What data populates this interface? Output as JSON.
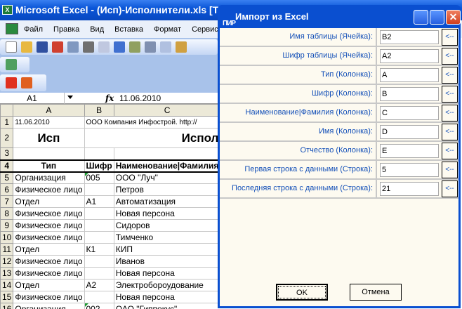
{
  "excel": {
    "title": "Microsoft Excel - (Исп)-Исполнители.xls  [Только чтение]",
    "menu": [
      "Файл",
      "Правка",
      "Вид",
      "Вставка",
      "Формат",
      "Сервис"
    ],
    "name_box": "A1",
    "fx_label": "fx",
    "formula_value": "11.06.2010",
    "columns": [
      "A",
      "B",
      "C"
    ],
    "rows": [
      {
        "n": "1",
        "a": "11.06.2010",
        "b": "ООО Компания Инфострой. http://",
        "c": ""
      },
      {
        "n": "2",
        "a": "Исп",
        "b": "",
        "c": "Испол"
      },
      {
        "n": "3",
        "a": "",
        "b": "",
        "c": ""
      },
      {
        "n": "4",
        "a": "Тип",
        "b": "Шифр",
        "c": "Наименование|Фамилия"
      },
      {
        "n": "5",
        "a": "Организация",
        "b": "005",
        "c": "ООО \"Луч\""
      },
      {
        "n": "6",
        "a": "Физическое лицо",
        "b": "",
        "c": "Петров"
      },
      {
        "n": "7",
        "a": "Отдел",
        "b": "А1",
        "c": "Автоматизация"
      },
      {
        "n": "8",
        "a": "Физическое лицо",
        "b": "",
        "c": "Новая персона"
      },
      {
        "n": "9",
        "a": "Физическое лицо",
        "b": "",
        "c": "Сидоров"
      },
      {
        "n": "10",
        "a": "Физическое лицо",
        "b": "",
        "c": "Тимченко"
      },
      {
        "n": "11",
        "a": "Отдел",
        "b": "К1",
        "c": "КИП"
      },
      {
        "n": "12",
        "a": "Физическое лицо",
        "b": "",
        "c": "Иванов"
      },
      {
        "n": "13",
        "a": "Физическое лицо",
        "b": "",
        "c": "Новая персона"
      },
      {
        "n": "14",
        "a": "Отдел",
        "b": "А2",
        "c": "Электробороудование"
      },
      {
        "n": "15",
        "a": "Физическое лицо",
        "b": "",
        "c": "Новая персона"
      },
      {
        "n": "16",
        "a": "Организация",
        "b": "002",
        "c": "ОАО \"Гиппокус\""
      }
    ]
  },
  "dialog": {
    "icon_text": "ПИР",
    "title": "Импорт из Excel",
    "fields": [
      {
        "label": "Имя таблицы (Ячейка):",
        "value": "B2",
        "pick": "<--"
      },
      {
        "label": "Шифр таблицы (Ячейка):",
        "value": "A2",
        "pick": "<--"
      },
      {
        "label": "Тип (Колонка):",
        "value": "A",
        "pick": "<--"
      },
      {
        "label": "Шифр (Колонка):",
        "value": "B",
        "pick": "<--"
      },
      {
        "label": "Наименование|Фамилия (Колонка):",
        "value": "C",
        "pick": "<--"
      },
      {
        "label": "Имя (Колонка):",
        "value": "D",
        "pick": "<--"
      },
      {
        "label": "Отчество (Колонка):",
        "value": "E",
        "pick": "<--"
      },
      {
        "label": "Первая строка с данными (Строка):",
        "value": "5",
        "pick": "<--"
      },
      {
        "label": "Последняя строка с данными (Строка):",
        "value": "21",
        "pick": "<--"
      }
    ],
    "ok_label": "OK",
    "cancel_label": "Отмена"
  }
}
